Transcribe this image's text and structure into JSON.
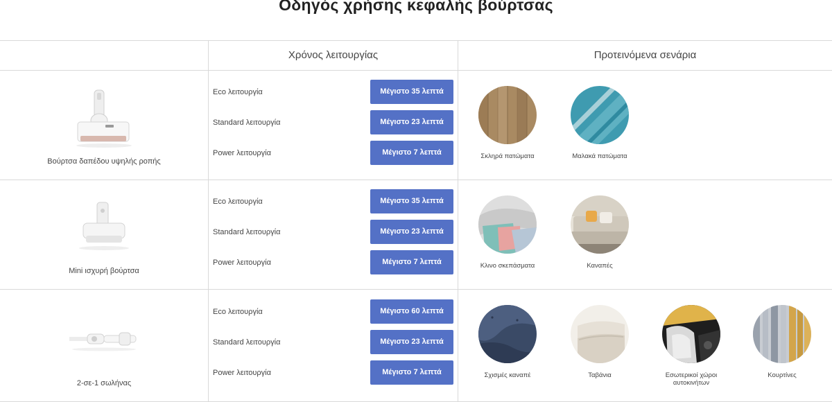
{
  "page": {
    "title": "Οδηγός χρήσης κεφαλής βούρτσας"
  },
  "header": {
    "col1": "",
    "col2": "Χρόνος λειτουργίας",
    "col3": "Προτεινόμενα σενάρια"
  },
  "rows": [
    {
      "product": "Βούρτσα δαπέδου υψηλής ροπής",
      "modes": [
        {
          "label": "Eco λειτουργία",
          "time": "Μέγιστο 35 λεπτά"
        },
        {
          "label": "Standard λειτουργία",
          "time": "Μέγιστο 23 λεπτά"
        },
        {
          "label": "Power λειτουργία",
          "time": "Μέγιστο 7 λεπτά"
        }
      ],
      "scenarios": [
        {
          "label": "Σκληρά πατώματα"
        },
        {
          "label": "Μαλακά πατώματα"
        }
      ]
    },
    {
      "product": "Mini ισχυρή βούρτσα",
      "modes": [
        {
          "label": "Eco λειτουργία",
          "time": "Μέγιστο 35 λεπτά"
        },
        {
          "label": "Standard λειτουργία",
          "time": "Μέγιστο 23 λεπτά"
        },
        {
          "label": "Power λειτουργία",
          "time": "Μέγιστο 7 λεπτά"
        }
      ],
      "scenarios": [
        {
          "label": "Κλινο σκεπάσματα"
        },
        {
          "label": "Καναπές"
        }
      ]
    },
    {
      "product": "2-σε-1 σωλήνας",
      "modes": [
        {
          "label": "Eco λειτουργία",
          "time": "Μέγιστο 60 λεπτά"
        },
        {
          "label": "Standard λειτουργία",
          "time": "Μέγιστο 23 λεπτά"
        },
        {
          "label": "Power λειτουργία",
          "time": "Μέγιστο 7 λεπτά"
        }
      ],
      "scenarios": [
        {
          "label": "Σχισμές καναπέ"
        },
        {
          "label": "Ταβάνια"
        },
        {
          "label": "Εσωτερικοί χώροι αυτοκινήτων"
        },
        {
          "label": "Κουρτίνες"
        }
      ]
    }
  ],
  "colors": {
    "button_bg": "#5471c6",
    "button_text": "#ffffff",
    "border": "#d9d9d9"
  }
}
